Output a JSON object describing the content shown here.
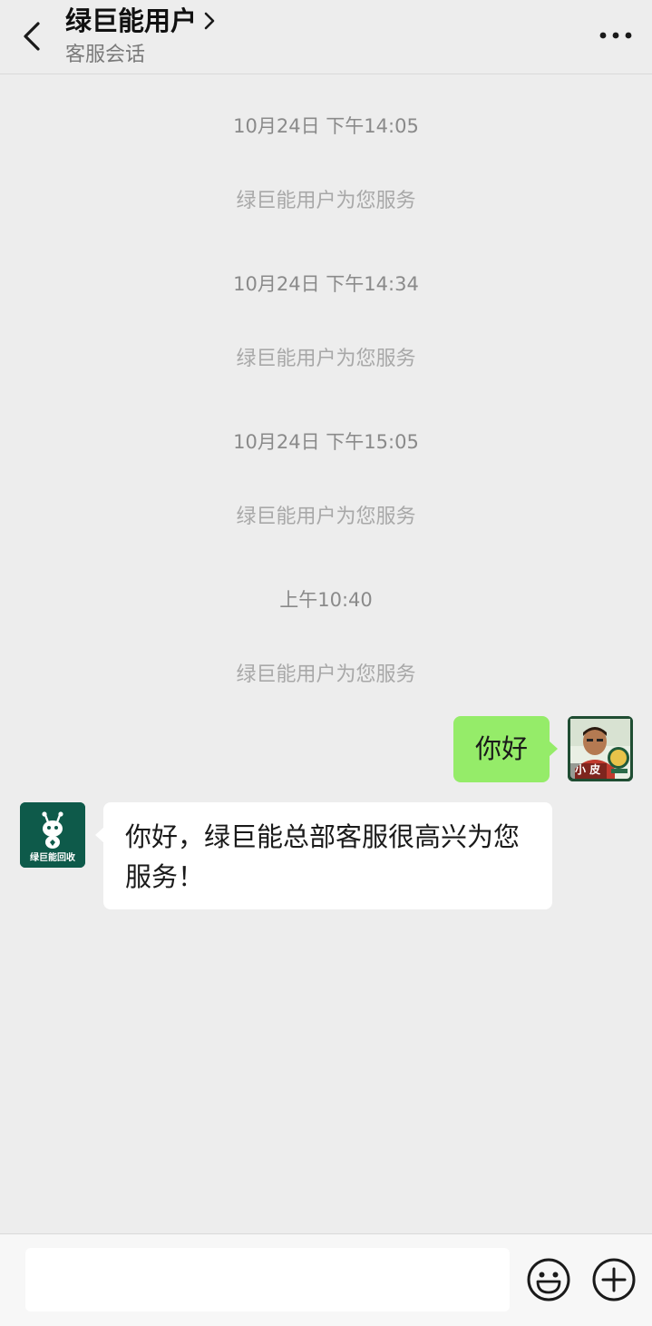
{
  "header": {
    "title": "绿巨能用户",
    "subtitle": "客服会话",
    "back_icon": "chevron-left-icon",
    "more_icon": "more-horizontal-icon"
  },
  "messages": {
    "timestamps": [
      "10月24日 下午14:05",
      "10月24日 下午14:34",
      "10月24日 下午15:05",
      "上午10:40"
    ],
    "system_notices": [
      "绿巨能用户为您服务",
      "绿巨能用户为您服务",
      "绿巨能用户为您服务",
      "绿巨能用户为您服务"
    ],
    "outgoing": {
      "text": "你好",
      "avatar_caption": "小 皮",
      "bubble_color": "#95ec69"
    },
    "incoming": {
      "line1": "你好，绿巨能总部客服很高兴为您",
      "line2": "服务！",
      "avatar_logo_text": "绿巨能回收",
      "avatar_color": "#0e5a4a"
    }
  },
  "input_bar": {
    "placeholder": "",
    "emoji_icon": "emoji-face-icon",
    "plus_icon": "plus-circle-icon"
  },
  "colors": {
    "background": "#ededed",
    "outgoing_bubble": "#95ec69",
    "incoming_bubble": "#ffffff",
    "brand_green": "#0e5a4a"
  }
}
